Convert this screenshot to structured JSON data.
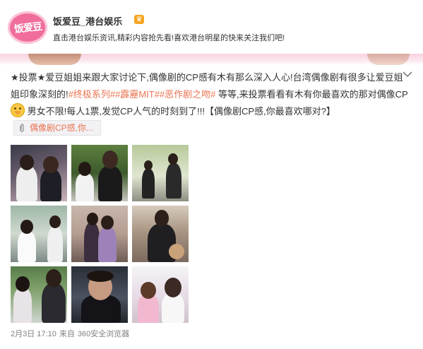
{
  "account": {
    "avatar_text": "饭爱豆",
    "name": "饭爱豆_港台娱乐",
    "badge_icon": "vip-badge-icon",
    "description": "直击港台娱乐资讯,精彩内容抢先看!喜欢港台明星的快来关注我们吧!"
  },
  "post": {
    "menu_icon": "chevron-down-icon",
    "text_part1": "★投票★爱豆姐姐来跟大家讨论下,偶像剧的CP感有木有那么深入人心!台湾偶像剧有很多让爱豆姐姐印象深刻的!",
    "hashtags": [
      "#终极系列#",
      "#霹靂MIT#",
      "#恶作剧之吻#"
    ],
    "text_part2": " 等等,来投票看看有木有你最喜欢的那对偶像CP",
    "emoji_icon": "shy-face-emoji-icon",
    "text_part3": " 男女不限!每人1票,发觉CP人气的时刻到了!!!【偶像剧CP感,你最喜欢哪对?】",
    "link_card_label": "偶像剧CP感,你...",
    "image_count": 9
  },
  "meta": {
    "date": "2月3日 17:10",
    "from_label": "来自",
    "source": "360安全浏览器"
  },
  "colors": {
    "hashtag": "#eb7350",
    "meta_text": "#808080",
    "avatar_pink": "#f06d9c",
    "banner_pink": "#f7d4df"
  }
}
